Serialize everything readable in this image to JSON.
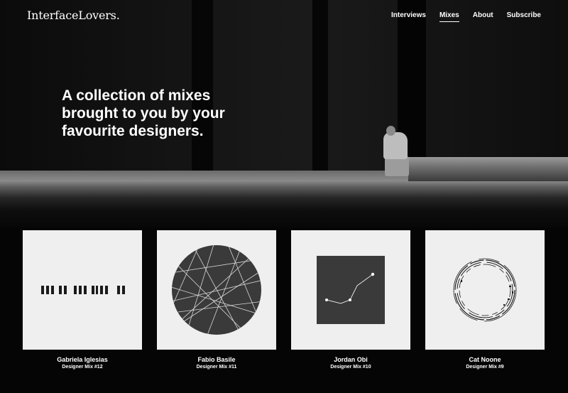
{
  "header": {
    "logo": "InterfaceLovers.",
    "nav": [
      {
        "label": "Interviews",
        "active": false
      },
      {
        "label": "Mixes",
        "active": true
      },
      {
        "label": "About",
        "active": false
      },
      {
        "label": "Subscribe",
        "active": false
      }
    ]
  },
  "hero": {
    "headline": "A collection of mixes brought to you by your favourite designers."
  },
  "mixes": [
    {
      "name": "Gabriela Iglesias",
      "subtitle": "Designer Mix #12",
      "art": "barcode-icon"
    },
    {
      "name": "Fabio Basile",
      "subtitle": "Designer Mix #11",
      "art": "circle-lines-icon"
    },
    {
      "name": "Jordan Obi",
      "subtitle": "Designer Mix #10",
      "art": "line-graph-icon"
    },
    {
      "name": "Cat Noone",
      "subtitle": "Designer Mix #9",
      "art": "broken-ring-icon"
    }
  ]
}
